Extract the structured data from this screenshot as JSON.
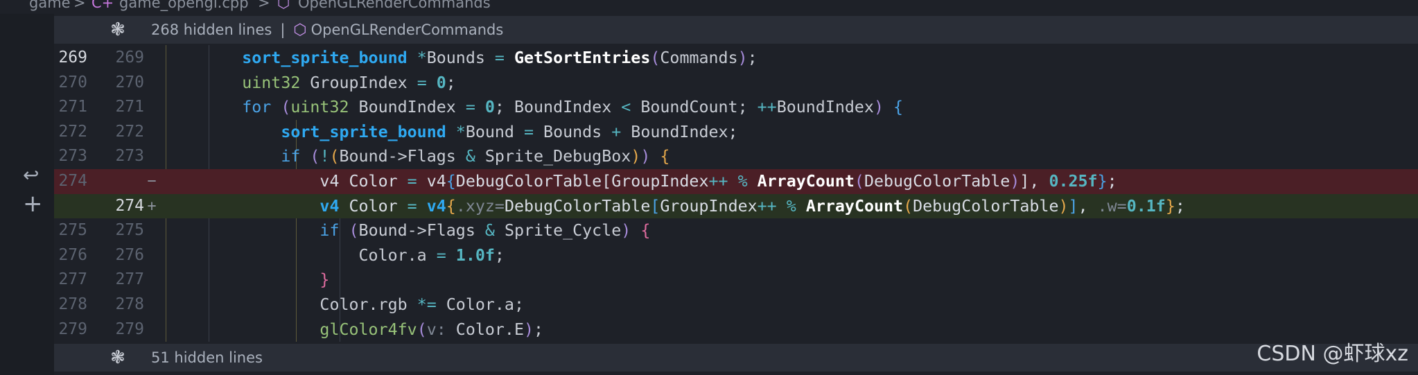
{
  "breadcrumb": {
    "part1": "game",
    "sep": ">",
    "file": "game_opengl.cpp",
    "symbol": "OpenGLRenderCommands"
  },
  "fold_top": {
    "hidden": "268 hidden lines",
    "divider": "|",
    "symbol": "OpenGLRenderCommands"
  },
  "fold_bottom": {
    "hidden": "51 hidden lines"
  },
  "lines": [
    {
      "old": "269",
      "new": "269"
    },
    {
      "old": "270",
      "new": "270"
    },
    {
      "old": "271",
      "new": "271"
    },
    {
      "old": "272",
      "new": "272"
    },
    {
      "old": "273",
      "new": "273"
    },
    {
      "old": "274",
      "new": "",
      "mark": "−"
    },
    {
      "old": "",
      "new": "274",
      "mark": "+"
    },
    {
      "old": "275",
      "new": "275"
    },
    {
      "old": "276",
      "new": "276"
    },
    {
      "old": "277",
      "new": "277"
    },
    {
      "old": "278",
      "new": "278"
    },
    {
      "old": "279",
      "new": "279"
    }
  ],
  "watermark": "CSDN @虾球xz"
}
